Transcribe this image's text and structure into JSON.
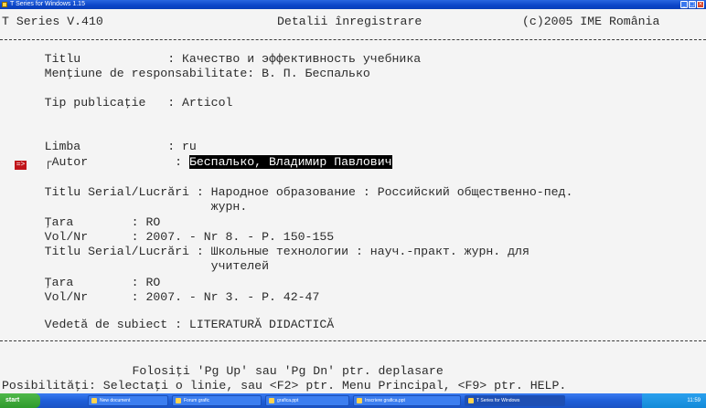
{
  "window": {
    "title": "T Series for Windows 1.15"
  },
  "header": {
    "left": "T Series V.410",
    "center": "Detalii înregistrare",
    "right": "(c)2005 IME România"
  },
  "record": {
    "titlu": "    Titlu            : Качество и эффективность учебника",
    "mentiune": "    Menţiune de responsabilitate: В. П. Беспалько",
    "tip": "    Tip publicaţie   : Articol",
    "limba": "    Limba            : ru",
    "autor_label": "    ┌Autor            : ",
    "autor_value": "Беспалько, Владимир Павлович",
    "serial1_1": "    Titlu Serial/Lucrări : Народное образование : Российский общественно-пед.",
    "serial1_2": "                           журн.",
    "tara1": "    Ţara        : RO",
    "vol1": "    Vol/Nr      : 2007. - Nr 8. - P. 150-155",
    "serial2_1": "    Titlu Serial/Lucrări : Школьные технологии : науч.-практ. журн. для",
    "serial2_2": "                           учителей",
    "tara2": "    Ţara        : RO",
    "vol2": "    Vol/Nr      : 2007. - Nr 3. - P. 42-47",
    "subiect": "    Vedetă de subiect : LITERATURĂ DIDACTICĂ"
  },
  "marker": "=>",
  "footer": {
    "line1": "                  Folosiţi 'Pg Up' sau 'Pg Dn' ptr. deplasare",
    "line2": "Posibilităţi: Selectaţi o linie, sau <F2> ptr. Menu Principal, <F9> ptr. HELP."
  },
  "taskbar": {
    "start": "start",
    "tasks": [
      "New document",
      "Forum grafic",
      "grafica.ppt",
      "Inscriere grafica.ppt",
      "T Series for Windows"
    ],
    "clock": "11:59"
  }
}
